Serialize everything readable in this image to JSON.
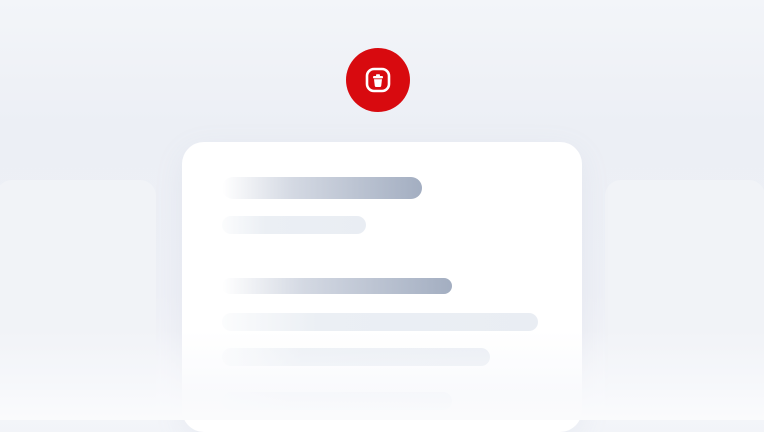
{
  "icons": {
    "badge": "trash-icon"
  },
  "colors": {
    "accent": "#d80a0f",
    "card": "#ffffff",
    "skeleton_dark": "#a3aec1",
    "skeleton_light": "#e9edf3"
  }
}
